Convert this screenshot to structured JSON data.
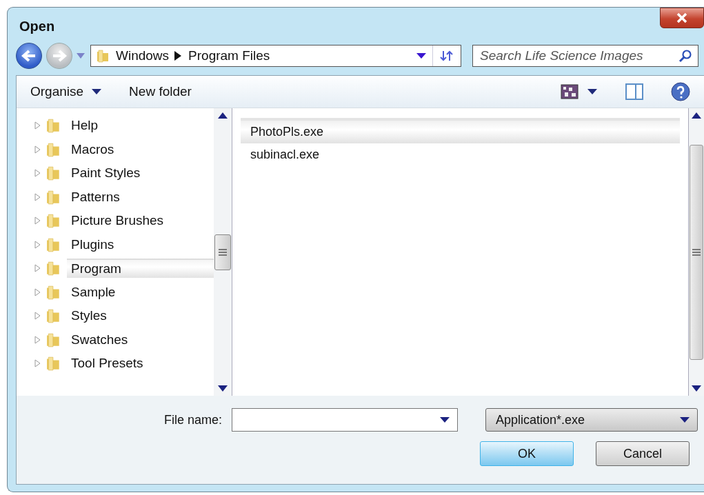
{
  "window": {
    "title": "Open"
  },
  "navigation": {
    "back": {
      "disabled": false
    },
    "forward": {
      "disabled": true
    },
    "path": [
      "Windows",
      "Program Files"
    ]
  },
  "search": {
    "placeholder": "Search Life Science Images"
  },
  "toolbar": {
    "organise": "Organise",
    "new_folder": "New folder"
  },
  "tree": [
    {
      "label": "Help",
      "selected": false
    },
    {
      "label": "Macros",
      "selected": false
    },
    {
      "label": "Paint Styles",
      "selected": false
    },
    {
      "label": "Patterns",
      "selected": false
    },
    {
      "label": "Picture Brushes",
      "selected": false
    },
    {
      "label": "Plugins",
      "selected": false
    },
    {
      "label": "Program",
      "selected": true
    },
    {
      "label": "Sample",
      "selected": false
    },
    {
      "label": "Styles",
      "selected": false
    },
    {
      "label": "Swatches",
      "selected": false
    },
    {
      "label": "Tool Presets",
      "selected": false
    }
  ],
  "files": [
    {
      "name": "PhotoPls.exe",
      "selected": true
    },
    {
      "name": "subinacl.exe",
      "selected": false
    }
  ],
  "file_name": {
    "label": "File name:"
  },
  "file_type": {
    "value": "Application*.exe"
  },
  "buttons": [
    {
      "label": "OK",
      "default": true
    },
    {
      "label": "Cancel",
      "default": false
    }
  ]
}
